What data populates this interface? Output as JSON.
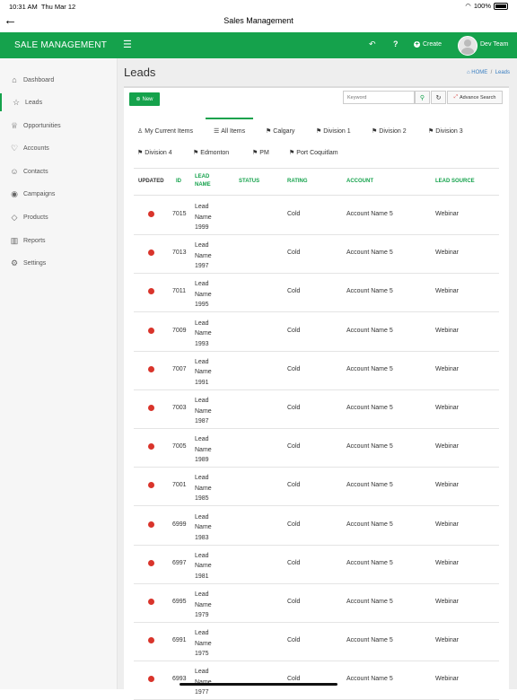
{
  "status": {
    "time": "10:31 AM",
    "date": "Thu Mar 12",
    "battery": "100%"
  },
  "nav": {
    "title": "Sales Management",
    "back_icon": "←"
  },
  "appbar": {
    "brand": "SALE MANAGEMENT",
    "create": "Create",
    "user": "Dev Team",
    "accent": "#15a24c"
  },
  "sidebar": {
    "items": [
      {
        "label": "Dashboard",
        "icon": "⌂"
      },
      {
        "label": "Leads",
        "icon": "☆"
      },
      {
        "label": "Opportunities",
        "icon": "♕"
      },
      {
        "label": "Accounts",
        "icon": "♡"
      },
      {
        "label": "Contacts",
        "icon": "☺"
      },
      {
        "label": "Campaigns",
        "icon": "◉"
      },
      {
        "label": "Products",
        "icon": "◇"
      },
      {
        "label": "Reports",
        "icon": "▥"
      },
      {
        "label": "Settings",
        "icon": "⚙"
      }
    ]
  },
  "page": {
    "title": "Leads",
    "breadcrumb_home": "HOME",
    "breadcrumb_current": "Leads"
  },
  "toolbar": {
    "new_label": "New",
    "keyword_placeholder": "Keyword",
    "advance_search": "Advance Search"
  },
  "tabs": [
    {
      "label": "My Current Items",
      "icon": "♙"
    },
    {
      "label": "All Items",
      "icon": "☰"
    },
    {
      "label": "Calgary",
      "icon": "⚑"
    },
    {
      "label": "Division 1",
      "icon": "⚑"
    },
    {
      "label": "Division 2",
      "icon": "⚑"
    },
    {
      "label": "Division 3",
      "icon": "⚑"
    },
    {
      "label": "Division 4",
      "icon": "⚑"
    },
    {
      "label": "Edmonton",
      "icon": "⚑"
    },
    {
      "label": "PM",
      "icon": "⚑"
    },
    {
      "label": "Port Coquitlam",
      "icon": "⚑"
    }
  ],
  "table": {
    "headers": [
      "UPDATED",
      "ID",
      "LEAD NAME",
      "STATUS",
      "RATING",
      "ACCOUNT",
      "LEAD SOURCE"
    ],
    "rows": [
      {
        "id": "7015",
        "name": "Lead Name 1999",
        "status": "",
        "rating": "Cold",
        "account": "Account Name 5",
        "source": "Webinar"
      },
      {
        "id": "7013",
        "name": "Lead Name 1997",
        "status": "",
        "rating": "Cold",
        "account": "Account Name 5",
        "source": "Webinar"
      },
      {
        "id": "7011",
        "name": "Lead Name 1995",
        "status": "",
        "rating": "Cold",
        "account": "Account Name 5",
        "source": "Webinar"
      },
      {
        "id": "7009",
        "name": "Lead Name 1993",
        "status": "",
        "rating": "Cold",
        "account": "Account Name 5",
        "source": "Webinar"
      },
      {
        "id": "7007",
        "name": "Lead Name 1991",
        "status": "",
        "rating": "Cold",
        "account": "Account Name 5",
        "source": "Webinar"
      },
      {
        "id": "7003",
        "name": "Lead Name 1987",
        "status": "",
        "rating": "Cold",
        "account": "Account Name 5",
        "source": "Webinar"
      },
      {
        "id": "7005",
        "name": "Lead Name 1989",
        "status": "",
        "rating": "Cold",
        "account": "Account Name 5",
        "source": "Webinar"
      },
      {
        "id": "7001",
        "name": "Lead Name 1985",
        "status": "",
        "rating": "Cold",
        "account": "Account Name 5",
        "source": "Webinar"
      },
      {
        "id": "6999",
        "name": "Lead Name 1983",
        "status": "",
        "rating": "Cold",
        "account": "Account Name 5",
        "source": "Webinar"
      },
      {
        "id": "6997",
        "name": "Lead Name 1981",
        "status": "",
        "rating": "Cold",
        "account": "Account Name 5",
        "source": "Webinar"
      },
      {
        "id": "6995",
        "name": "Lead Name 1979",
        "status": "",
        "rating": "Cold",
        "account": "Account Name 5",
        "source": "Webinar"
      },
      {
        "id": "6991",
        "name": "Lead Name 1975",
        "status": "",
        "rating": "Cold",
        "account": "Account Name 5",
        "source": "Webinar"
      },
      {
        "id": "6993",
        "name": "Lead Name 1977",
        "status": "",
        "rating": "Cold",
        "account": "Account Name 5",
        "source": "Webinar"
      }
    ]
  }
}
